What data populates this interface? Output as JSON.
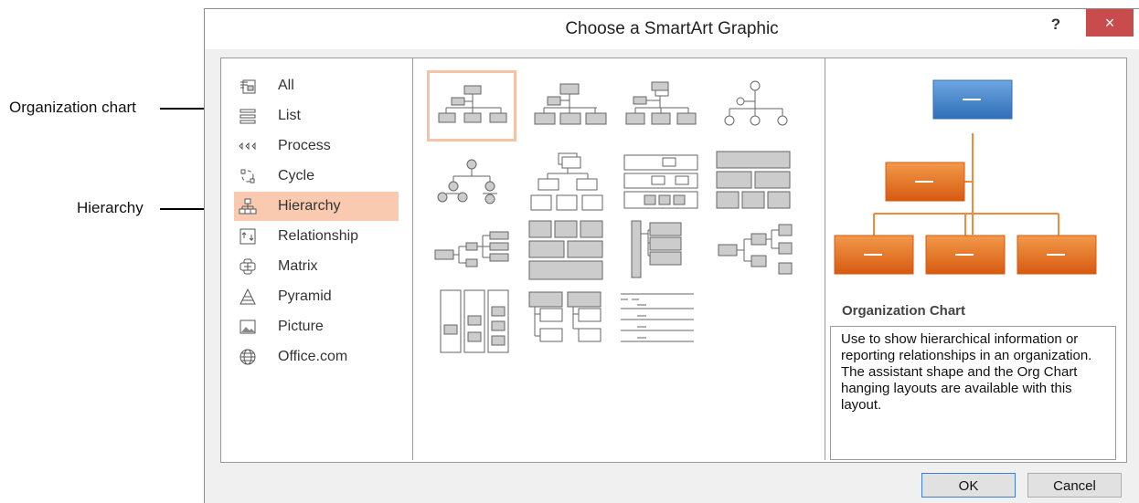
{
  "callouts": {
    "org_chart": "Organization chart",
    "hierarchy": "Hierarchy"
  },
  "dialog": {
    "title": "Choose a SmartArt Graphic",
    "help": "?",
    "close": "×"
  },
  "categories": [
    {
      "label": "All",
      "icon": "all-icon"
    },
    {
      "label": "List",
      "icon": "list-icon"
    },
    {
      "label": "Process",
      "icon": "process-icon"
    },
    {
      "label": "Cycle",
      "icon": "cycle-icon"
    },
    {
      "label": "Hierarchy",
      "icon": "hierarchy-icon",
      "selected": true
    },
    {
      "label": "Relationship",
      "icon": "relationship-icon"
    },
    {
      "label": "Matrix",
      "icon": "matrix-icon"
    },
    {
      "label": "Pyramid",
      "icon": "pyramid-icon"
    },
    {
      "label": "Picture",
      "icon": "picture-icon"
    },
    {
      "label": "Office.com",
      "icon": "globe-icon"
    }
  ],
  "preview": {
    "title": "Organization Chart",
    "description": "Use to show hierarchical information or reporting relationships in an organization. The assistant shape and the Org Chart hanging layouts are available with this layout."
  },
  "buttons": {
    "ok": "OK",
    "cancel": "Cancel"
  },
  "colors": {
    "selection": "#f9c9b0",
    "close": "#c94c4c",
    "preview_top": "#3b7dc4",
    "preview_boxes": "#e26b1f"
  }
}
